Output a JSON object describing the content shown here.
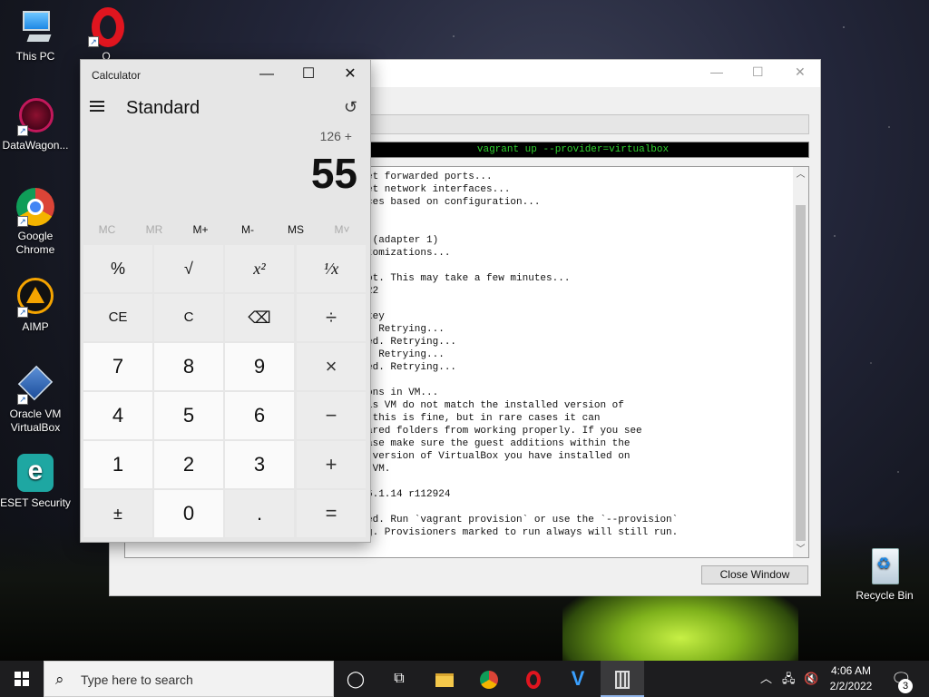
{
  "desktop": {
    "icons": [
      {
        "label": "This PC",
        "icon": "computer-icon"
      },
      {
        "label": "O",
        "icon": "opera-icon"
      },
      {
        "label": "DataWagon...",
        "icon": "datawagon-icon"
      },
      {
        "label": "Google Chrome",
        "icon": "chrome-icon"
      },
      {
        "label": "AIMP",
        "icon": "aimp-icon"
      },
      {
        "label": "Oracle VM VirtualBox",
        "icon": "virtualbox-icon"
      },
      {
        "label": "ESET Security",
        "icon": "eset-icon"
      },
      {
        "label": "Recycle Bin",
        "icon": "recycle-bin-icon"
      }
    ]
  },
  "background_window": {
    "command": "vagrant up --provider=virtualbox",
    "log_lines": [
      "et forwarded ports...",
      "et network interfaces...",
      "ces based on configuration...",
      "",
      "",
      " (adapter 1)",
      "tomizations...",
      "",
      "ot. This may take a few minutes...",
      "22",
      "",
      "key",
      ". Retrying...",
      "ed. Retrying...",
      ". Retrying...",
      "ed. Retrying...",
      "",
      "ons in VM...",
      "is VM do not match the installed version of",
      " this is fine, but in rare cases it can",
      "ared folders from working properly. If you see",
      "ase make sure the guest additions within the",
      " version of VirtualBox you have installed on",
      " VM.",
      "",
      "6.1.14 r112924",
      "",
      "ed. Run `vagrant provision` or use the `--provision`",
      "g. Provisioners marked to run always will still run."
    ],
    "close_label": "Close Window"
  },
  "calculator": {
    "title": "Calculator",
    "mode": "Standard",
    "expression": "126 +",
    "display": "55",
    "memory": {
      "mc": "MC",
      "mr": "MR",
      "mplus": "M+",
      "mminus": "M-",
      "ms": "MS",
      "mlist": "M˅"
    },
    "keys": {
      "percent": "%",
      "sqrt": "√",
      "square": "x²",
      "reciprocal": "¹⁄x",
      "ce": "CE",
      "c": "C",
      "backspace": "⌫",
      "divide": "÷",
      "n7": "7",
      "n8": "8",
      "n9": "9",
      "multiply": "×",
      "n4": "4",
      "n5": "5",
      "n6": "6",
      "minus": "−",
      "n1": "1",
      "n2": "2",
      "n3": "3",
      "plus": "+",
      "negate": "±",
      "n0": "0",
      "decimal": ".",
      "equals": "="
    }
  },
  "taskbar": {
    "search_placeholder": "Type here to search",
    "time": "4:06 AM",
    "date": "2/2/2022",
    "notification_count": "3"
  }
}
